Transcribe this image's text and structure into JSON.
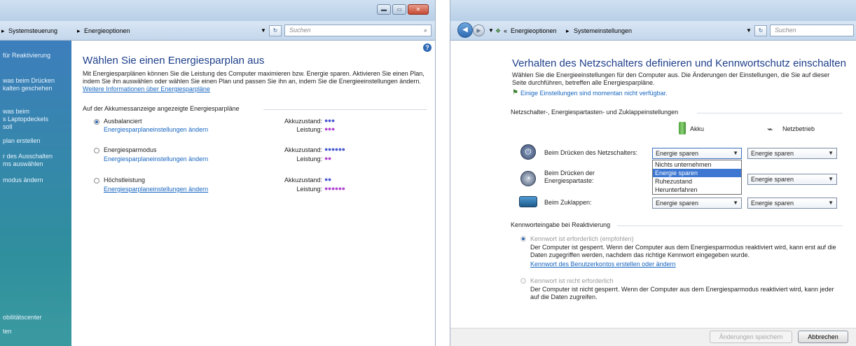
{
  "left": {
    "addr": {
      "crumb1": "Systemsteuerung",
      "sep": "▸",
      "crumb2": "Energieoptionen",
      "search_placeholder": "Suchen",
      "refresh": "↻"
    },
    "winbtns": {
      "min": "▬",
      "max": "▭",
      "close": "✕"
    },
    "help": "?",
    "sidebar": [
      "für Reaktivierung",
      "was beim Drücken\nkalten geschehen",
      "was beim\ns Laptopdeckels\nsoll",
      "plan erstellen",
      "r des Ausschalten\nms auswählen",
      "modus ändern",
      "obilitätscenter",
      "ten"
    ],
    "title": "Wählen Sie einen Energiesparplan aus",
    "intro_text": "Mit Energiesparplänen können Sie die Leistung des Computer maximieren bzw. Energie sparen. Aktivieren Sie einen Plan, indem Sie ihn auswählen oder wählen Sie einen Plan und passen Sie ihn an, indem Sie die Energieeinstellungen ändern.",
    "intro_link": "Weitere Informationen über Energiesparpläne",
    "section": "Auf der Akkumessanzeige angezeigte Energiesparpläne",
    "plans": [
      {
        "name": "Ausbalanciert",
        "link": "Energiesparplaneinstellungen ändern",
        "akku_label": "Akkuzustand:",
        "akku": "●●●",
        "leistung_label": "Leistung:",
        "leistung": "●●●"
      },
      {
        "name": "Energiesparmodus",
        "link": "Energiesparplaneinstellungen ändern",
        "akku_label": "Akkuzustand:",
        "akku": "●●●●●●",
        "leistung_label": "Leistung:",
        "leistung": "●●"
      },
      {
        "name": "Höchstleistung",
        "link": "Energiesparplaneinstellungen ändern",
        "akku_label": "Akkuzustand:",
        "akku": "●●",
        "leistung_label": "Leistung:",
        "leistung": "●●●●●●"
      }
    ]
  },
  "right": {
    "addr": {
      "crumb1": "Energieoptionen",
      "sep": "▸",
      "crumb2": "Systemeinstellungen",
      "search_placeholder": "Suchen",
      "back": "◀",
      "fwd": "▶",
      "refresh": "↻"
    },
    "title": "Verhalten des Netzschalters definieren und Kennwortschutz einschalten",
    "intro": "Wählen Sie die Energieeinstellungen für den Computer aus. Die Änderungen der Einstellungen, die Sie auf dieser Seite durchführen, betreffen alle Energiesparpläne.",
    "unavailable_link": "Einige Einstellungen sind momentan nicht verfügbar.",
    "section1": "Netzschalter-, Energiespartasten- und Zuklappeinstellungen",
    "col_akku": "Akku",
    "col_netz": "Netzbetrieb",
    "rows": [
      {
        "label": "Beim Drücken des Netzschalters:",
        "akku": "Energie sparen",
        "netz": "Energie sparen"
      },
      {
        "label": "Beim Drücken der\nEnergiespartaste:",
        "akku": "Energie sparen",
        "netz": "Energie sparen"
      },
      {
        "label": "Beim Zuklappen:",
        "akku": "Energie sparen",
        "netz": "Energie sparen"
      }
    ],
    "dropdown_options": [
      "Nichts unternehmen",
      "Energie sparen",
      "Ruhezustand",
      "Herunterfahren"
    ],
    "dropdown_selected": "Energie sparen",
    "section2": "Kennworteingabe bei Reaktivierung",
    "pw_required_label": "Kennwort ist erforderlich (empfohlen)",
    "pw_required_desc": "Der Computer ist gesperrt. Wenn der Computer aus dem Energiesparmodus reaktiviert wird, kann erst auf die Daten zugegriffen werden, nachdem das richtige Kennwort eingegeben wurde.",
    "pw_required_link": "Kennwort des Benutzerkontos erstellen oder ändern",
    "pw_not_label": "Kennwort ist nicht erforderlich",
    "pw_not_desc": "Der Computer ist nicht gesperrt. Wenn der Computer aus dem Energiesparmodus reaktiviert wird, kann jeder auf die Daten zugreifen.",
    "save_button": "Änderungen speichern",
    "cancel_button": "Abbrechen"
  }
}
